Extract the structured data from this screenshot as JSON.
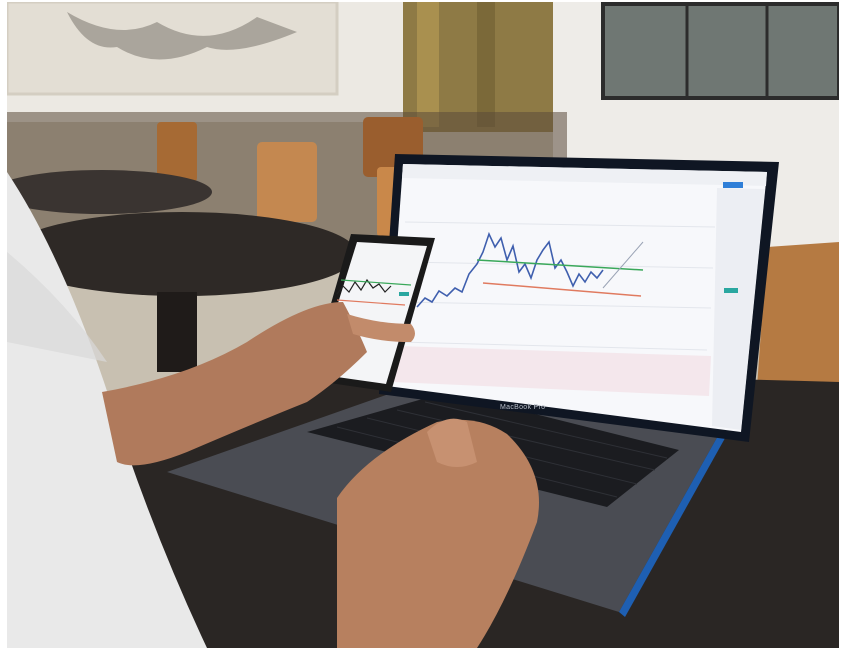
{
  "photo": {
    "subject": "trading-chart-on-laptop-and-phone",
    "laptop_label": "MacBook Pro",
    "colors": {
      "wall": "#ece9e3",
      "table_top": "#2a2624",
      "laptop_body": "#4a4c53",
      "laptop_edge": "#1e5fb2",
      "keyboard": "#1b1c20",
      "screen_bg": "#f7f8fb",
      "candles": "#3f5fae",
      "support_line": "#3aa85a",
      "resistance_line": "#e07a5f",
      "chair_wood": "#b07840",
      "skin": "#b07a5c",
      "shirt": "#e9e9e9"
    }
  }
}
